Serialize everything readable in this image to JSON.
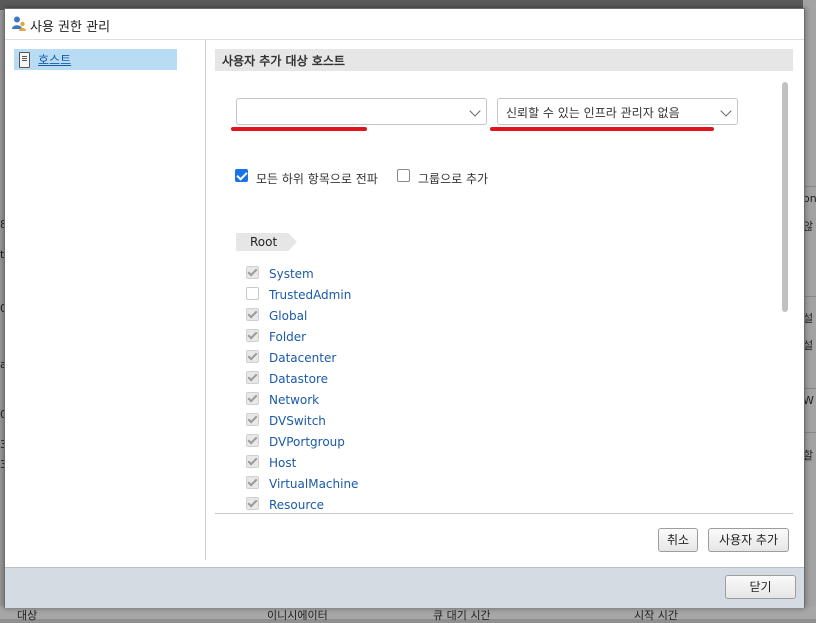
{
  "background": {
    "right_fragments": [
      "on",
      "않",
      "설",
      "설",
      "W",
      "할"
    ],
    "left_fragments": [
      "8",
      "t",
      "0",
      "a",
      "0",
      "3",
      "3"
    ],
    "bottom_columns": [
      "대상",
      "이니시에이터",
      "큐 대기 시간",
      "시작 시간"
    ]
  },
  "dialog": {
    "title": "사용 권한 관리",
    "title_icon": "users-icon"
  },
  "sidebar": {
    "items": [
      {
        "label": "호스트",
        "icon": "host-icon",
        "selected": true
      }
    ]
  },
  "main": {
    "section_title": "사용자 추가 대상 호스트",
    "user_select": {
      "value": "",
      "icon": "chevron-down-icon"
    },
    "role_select": {
      "value": "신뢰할 수 있는 인프라 관리자 없음",
      "icon": "chevron-down-icon"
    },
    "options": {
      "propagate": {
        "label": "모든 하위 항목으로 전파",
        "checked": true
      },
      "add_as_group": {
        "label": "그룹으로 추가",
        "checked": false
      }
    },
    "breadcrumb": "Root",
    "privileges": [
      {
        "name": "System",
        "checked": true
      },
      {
        "name": "TrustedAdmin",
        "checked": false
      },
      {
        "name": "Global",
        "checked": true
      },
      {
        "name": "Folder",
        "checked": true
      },
      {
        "name": "Datacenter",
        "checked": true
      },
      {
        "name": "Datastore",
        "checked": true
      },
      {
        "name": "Network",
        "checked": true
      },
      {
        "name": "DVSwitch",
        "checked": true
      },
      {
        "name": "DVPortgroup",
        "checked": true
      },
      {
        "name": "Host",
        "checked": true
      },
      {
        "name": "VirtualMachine",
        "checked": true
      },
      {
        "name": "Resource",
        "checked": true
      }
    ],
    "cancel_label": "취소",
    "add_user_label": "사용자 추가"
  },
  "footer": {
    "close_label": "닫기"
  },
  "colors": {
    "accent": "#1a73e8",
    "link": "#1a5aa8",
    "selection": "#b9dcf5",
    "annotation": "#e0141c"
  }
}
